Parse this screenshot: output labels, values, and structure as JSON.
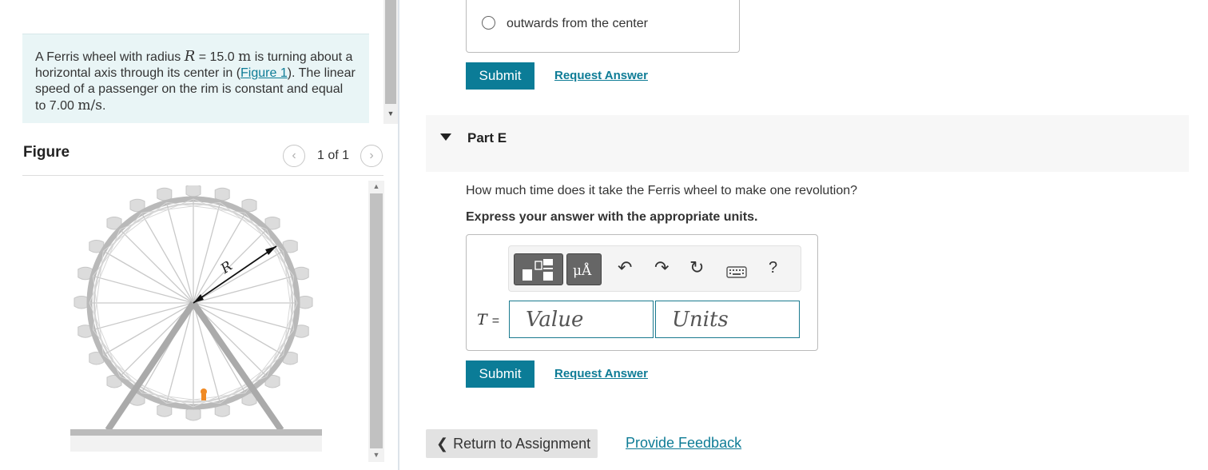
{
  "problem": {
    "p1": "A Ferris wheel with radius ",
    "r_var": "R",
    "p2": " = 15.0 ",
    "m_unit": "m",
    "p3": " is turning about a horizontal axis through its center in (",
    "figure_link": "Figure 1",
    "p4": "). The linear speed of a passenger on the rim is constant and equal to 7.00 ",
    "speed_unit": "m/s",
    "p5": "."
  },
  "figure": {
    "title": "Figure",
    "pager_text": "1 of 1",
    "radius_label": "R"
  },
  "prev_part": {
    "choice_label": "outwards from the center",
    "submit_label": "Submit",
    "request_label": "Request Answer"
  },
  "part_e": {
    "title": "Part E",
    "question": "How much time does it take the Ferris wheel to make one revolution?",
    "instruction": "Express your answer with the appropriate units.",
    "toolbar": {
      "units_glyph": "μÅ",
      "undo_icon": "undo-icon",
      "redo_icon": "redo-icon",
      "reset_icon": "reset-icon",
      "keyboard_icon": "keyboard-icon",
      "help_label": "?"
    },
    "var_label": "T",
    "equals": "=",
    "value_placeholder": "Value",
    "units_placeholder": "Units",
    "submit_label": "Submit",
    "request_label": "Request Answer"
  },
  "footer": {
    "back_label": "Return to Assignment",
    "feedback_label": "Provide Feedback"
  }
}
